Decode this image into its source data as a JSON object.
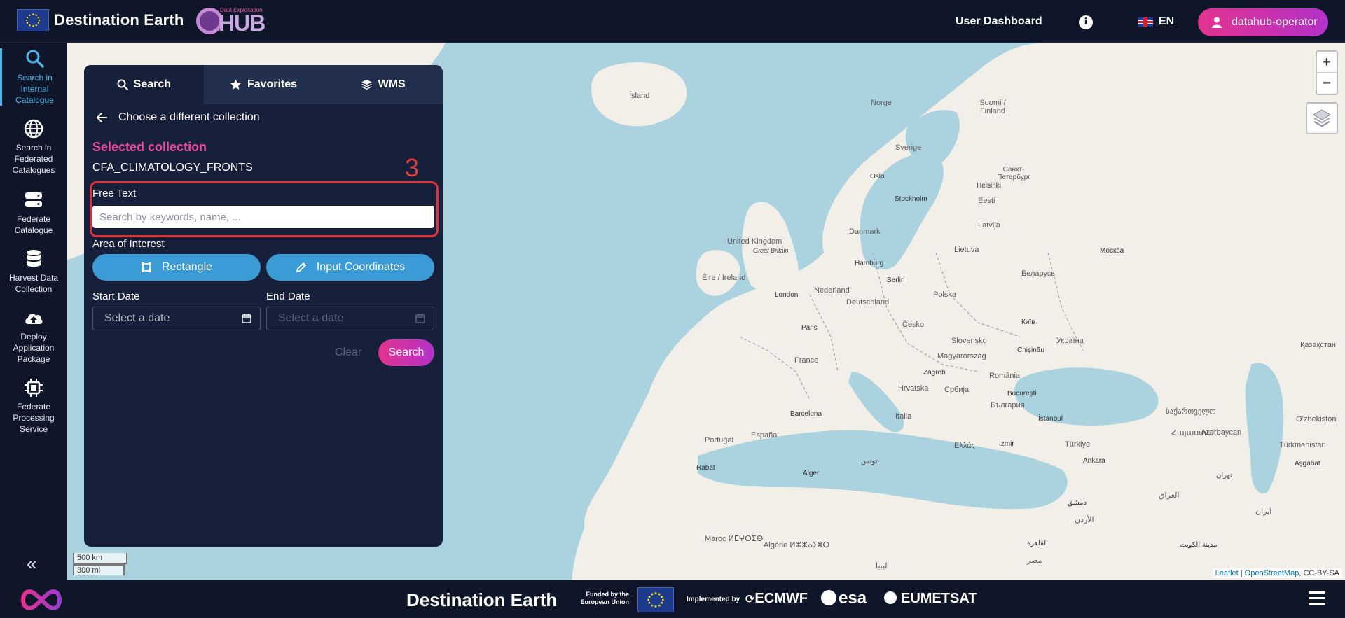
{
  "header": {
    "brand": "Destination Earth",
    "hub_sub": "Data Exploitation",
    "hub_label": "HUB",
    "nav_dashboard": "User Dashboard",
    "info_icon": "info-icon",
    "language": "EN",
    "user": "datahub-operator"
  },
  "sidebar": {
    "items": [
      {
        "label": "Search in Internal Catalogue",
        "icon": "search-icon"
      },
      {
        "label": "Search in Federated Catalogues",
        "icon": "globe-icon"
      },
      {
        "label": "Federate Catalogue",
        "icon": "server-icon"
      },
      {
        "label": "Harvest Data Collection",
        "icon": "database-icon"
      },
      {
        "label": "Deploy Application Package",
        "icon": "cloud-upload-icon"
      },
      {
        "label": "Federate Processing Service",
        "icon": "chip-icon"
      }
    ],
    "collapse": "«"
  },
  "panel": {
    "tabs": [
      {
        "label": "Search",
        "icon": "search-icon"
      },
      {
        "label": "Favorites",
        "icon": "star-icon"
      },
      {
        "label": "WMS",
        "icon": "layers-icon"
      }
    ],
    "back_label": "Choose a different collection",
    "selected_label": "Selected collection",
    "selected_value": "CFA_CLIMATOLOGY_FRONTS",
    "annotation_number": "3",
    "free_text_label": "Free Text",
    "free_text_placeholder": "Search by keywords, name, ...",
    "free_text_value": "",
    "aoi_label": "Area of Interest",
    "rectangle_button": "Rectangle",
    "coords_button": "Input Coordinates",
    "start_date_label": "Start Date",
    "end_date_label": "End Date",
    "start_date_placeholder": "Select a date",
    "end_date_placeholder": "Select a date",
    "clear_button": "Clear",
    "search_button": "Search"
  },
  "map": {
    "zoom_in": "+",
    "zoom_out": "−",
    "scale_km": "500 km",
    "scale_mi": "300 mi",
    "attribution_leaflet": "Leaflet",
    "attribution_sep": " | ",
    "attribution_osm": "OpenStreetMap",
    "attribution_license": ", CC-BY-SA",
    "labels": {
      "island": "Ísland",
      "norge": "Norge",
      "suomi": "Suomi / Finland",
      "sverige": "Sverige",
      "spb": "Санкт-Петербург",
      "helsinki": "Helsinki",
      "oslo": "Oslo",
      "stockholm": "Stockholm",
      "eesti": "Eesti",
      "latvija": "Latvija",
      "lietuva": "Lietuva",
      "danmark": "Danmark",
      "uk": "United Kingdom",
      "gb": "Great Britain",
      "eire": "Éire / Ireland",
      "london": "London",
      "nederland": "Nederland",
      "hamburg": "Hamburg",
      "berlin": "Berlin",
      "deutschland": "Deutschland",
      "polska": "Polska",
      "belarus": "Беларусь",
      "moskva": "Москва",
      "paris": "Paris",
      "cesko": "Česko",
      "slovensko": "Slovensko",
      "kyiv": "Київ",
      "ukraine": "Україна",
      "france": "France",
      "magyar": "Magyarország",
      "chisinau": "Chișinău",
      "zagreb": "Zagreb",
      "hrvatska": "Hrvatska",
      "srbija": "Србија",
      "romania": "România",
      "bucuresti": "București",
      "bulgaria": "България",
      "kazakhstan": "Қазақстан",
      "barcelona": "Barcelona",
      "italia": "Italia",
      "istanbul": "İstanbul",
      "georgia": "საქართველო",
      "armenia": "Հայաստան",
      "portugal": "Portugal",
      "espana": "España",
      "ellas": "Ελλάς",
      "izmir": "İzmir",
      "turkiye": "Türkiye",
      "azerbaycan": "Azərbaycan",
      "ozbekiston": "Oʻzbekiston",
      "turkmenistan": "Türkmenistan",
      "ashgabat": "Aşgabat",
      "rabat": "Rabat",
      "alger": "Alger",
      "tunis": "تونس",
      "ankara": "Ankara",
      "damascus": "دمشق",
      "tehran": "تهران",
      "iraq": "العراق",
      "maroc": "Maroc ⵍⵎⵖⵔⵉⴱ",
      "algerie": "Algérie ⵍⵣⵣⴰⵢⴻⵔ",
      "libya": "ليبيا",
      "misr": "مصر",
      "cairo": "القاهرة",
      "jordan": "الأردن",
      "iran": "ایران",
      "kuwait": "مدينة الكويت"
    }
  },
  "footer": {
    "brand": "Destination Earth",
    "funded": "Funded by the European Union",
    "implemented": "Implemented by",
    "ecmwf": "ECMWF",
    "esa": "esa",
    "eumetsat": "EUMETSAT"
  }
}
